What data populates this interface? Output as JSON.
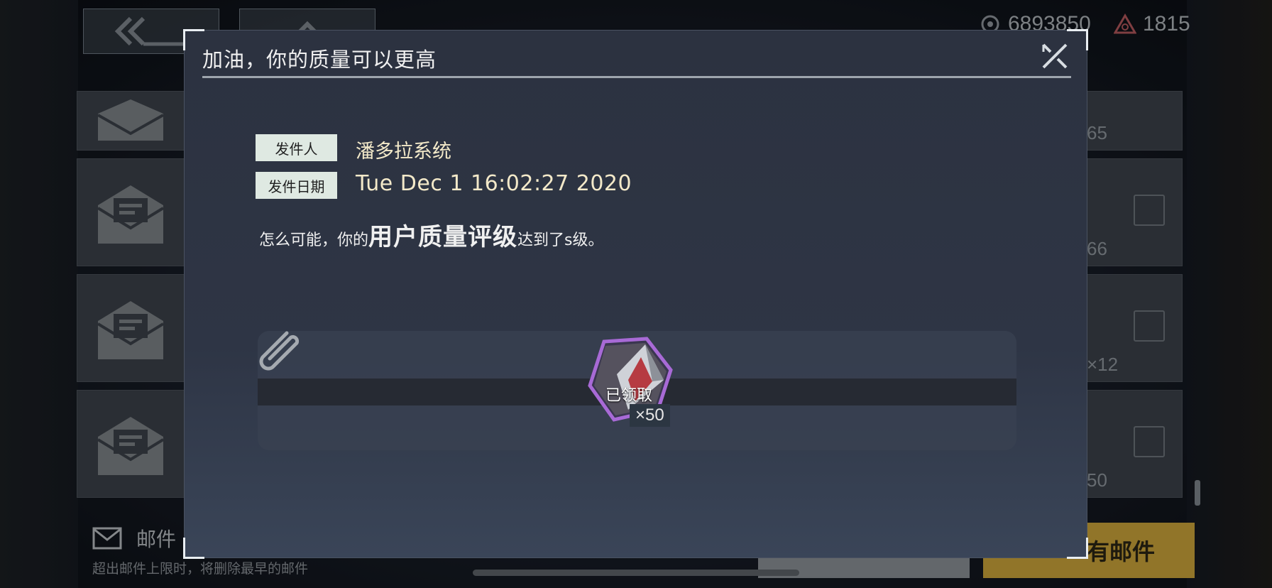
{
  "background": {
    "resources": [
      {
        "icon": "eye-coin-icon",
        "value": "6893850"
      },
      {
        "icon": "triangle-gem-icon",
        "value": "1815"
      }
    ],
    "right_list_counts": [
      "65",
      "66",
      "×12",
      "50"
    ],
    "footer": {
      "mail_label": "邮件",
      "hint": "超出邮件上限时，将删除最早的邮件",
      "gold_button_label": "有邮件"
    }
  },
  "modal": {
    "title": "加油，你的质量可以更高",
    "close_icon": "close-icon",
    "sender_label": "发件人",
    "sender_value": "潘多拉系统",
    "date_label": "发件日期",
    "date_value": "Tue Dec  1 16:02:27 2020",
    "body": {
      "pre": "怎么可能，你的",
      "emphasis": "用户质量评级",
      "post": "达到了s级。"
    },
    "attachment": {
      "icon": "paperclip-icon",
      "items": [
        {
          "icon": "crystal-reward-icon",
          "status": "已领取",
          "quantity": "×50",
          "accent": "#a86ad6"
        }
      ]
    }
  }
}
